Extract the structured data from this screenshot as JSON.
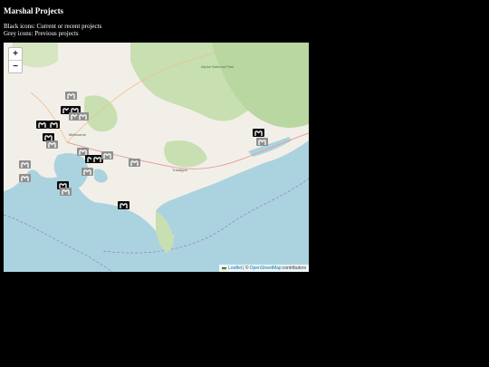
{
  "title": "Marshal Projects",
  "legend": {
    "black": "Black icons: Current or recent projects",
    "grey": "Grey icons: Previous projects"
  },
  "map": {
    "zoom_in": "+",
    "zoom_out": "−",
    "attribution": {
      "leaflet": "Leaflet",
      "separator": " | © ",
      "osm": "OpenStreetMap",
      "suffix": " contributors"
    },
    "places": {
      "melbourne": "Melbourne",
      "traralgon": "Traralgon",
      "alpine_park": "Alpine National Park"
    },
    "icon_name": "marshal-m-icon",
    "markers": [
      {
        "status": "previous"
      },
      {
        "status": "current"
      },
      {
        "status": "current"
      },
      {
        "status": "previous"
      },
      {
        "status": "previous"
      },
      {
        "status": "current"
      },
      {
        "status": "current"
      },
      {
        "status": "current"
      },
      {
        "status": "previous"
      },
      {
        "status": "previous"
      },
      {
        "status": "current"
      },
      {
        "status": "current"
      },
      {
        "status": "previous"
      },
      {
        "status": "previous"
      },
      {
        "status": "previous"
      },
      {
        "status": "previous"
      },
      {
        "status": "previous"
      },
      {
        "status": "current"
      },
      {
        "status": "previous"
      },
      {
        "status": "current"
      },
      {
        "status": "current"
      },
      {
        "status": "previous"
      }
    ],
    "colors": {
      "current": "#0b0b0b",
      "previous": "#8f8f8f",
      "water": "#aad3df",
      "land": "#f2efe9",
      "forest": "#c8dfb1"
    }
  }
}
